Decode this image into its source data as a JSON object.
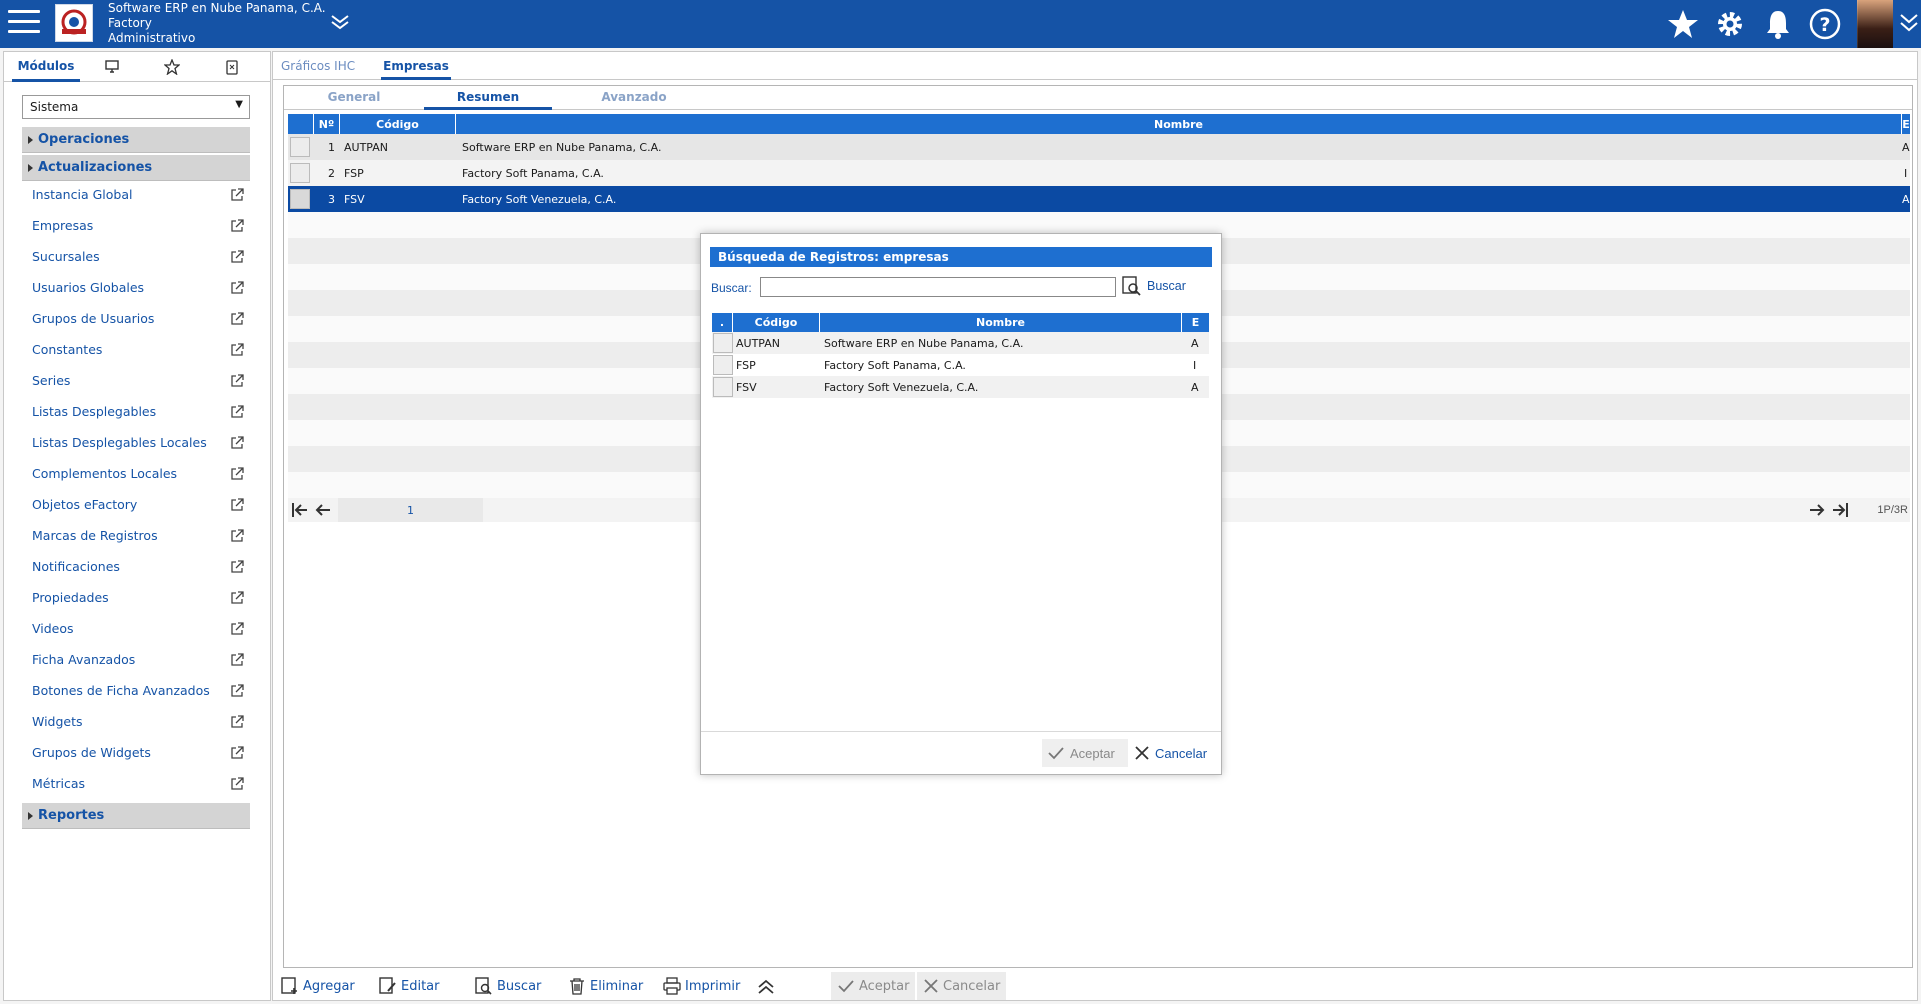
{
  "header": {
    "company": "Software ERP en Nube Panama, C.A.",
    "line2": "Factory",
    "line3": "Administrativo"
  },
  "left": {
    "tabs": [
      "Módulos"
    ],
    "select": "Sistema",
    "groups": {
      "operaciones": "Operaciones",
      "actualizaciones": "Actualizaciones",
      "reportes": "Reportes"
    },
    "items": [
      "Instancia Global",
      "Empresas",
      "Sucursales",
      "Usuarios Globales",
      "Grupos de Usuarios",
      "Constantes",
      "Series",
      "Listas Desplegables",
      "Listas Desplegables Locales",
      "Complementos Locales",
      "Objetos eFactory",
      "Marcas de Registros",
      "Notificaciones",
      "Propiedades",
      "Videos",
      "Ficha Avanzados",
      "Botones de Ficha Avanzados",
      "Widgets",
      "Grupos de Widgets",
      "Métricas"
    ]
  },
  "main": {
    "tabs": [
      "Gráficos IHC",
      "Empresas"
    ],
    "subtabs": [
      "General",
      "Resumen",
      "Avanzado"
    ],
    "grid": {
      "headers": {
        "num": "Nº",
        "code": "Código",
        "name": "Nombre",
        "e": "E"
      },
      "rows": [
        {
          "n": "1",
          "code": "AUTPAN",
          "name": "Software ERP en Nube Panama, C.A.",
          "e": "A"
        },
        {
          "n": "2",
          "code": "FSP",
          "name": "Factory Soft Panama, C.A.",
          "e": "I"
        },
        {
          "n": "3",
          "code": "FSV",
          "name": "Factory Soft Venezuela, C.A.",
          "e": "A"
        }
      ]
    },
    "pager": {
      "page": "1",
      "info": "1P/3R"
    },
    "toolbar": {
      "add": "Agregar",
      "edit": "Editar",
      "search": "Buscar",
      "delete": "Eliminar",
      "print": "Imprimir",
      "accept": "Aceptar",
      "cancel": "Cancelar"
    }
  },
  "modal": {
    "title": "Búsqueda de Registros: empresas",
    "search_label": "Buscar:",
    "search_value": "",
    "search_button": "Buscar",
    "headers": {
      "sel": ".",
      "code": "Código",
      "name": "Nombre",
      "e": "E"
    },
    "rows": [
      {
        "code": "AUTPAN",
        "name": "Software ERP en Nube Panama, C.A.",
        "e": "A"
      },
      {
        "code": "FSP",
        "name": "Factory Soft Panama, C.A.",
        "e": "I"
      },
      {
        "code": "FSV",
        "name": "Factory Soft Venezuela, C.A.",
        "e": "A"
      }
    ],
    "accept": "Aceptar",
    "cancel": "Cancelar"
  },
  "colors": {
    "primary": "#1553a6",
    "header_blue": "#1e6fd0",
    "selected_row": "#0b4aa3"
  }
}
